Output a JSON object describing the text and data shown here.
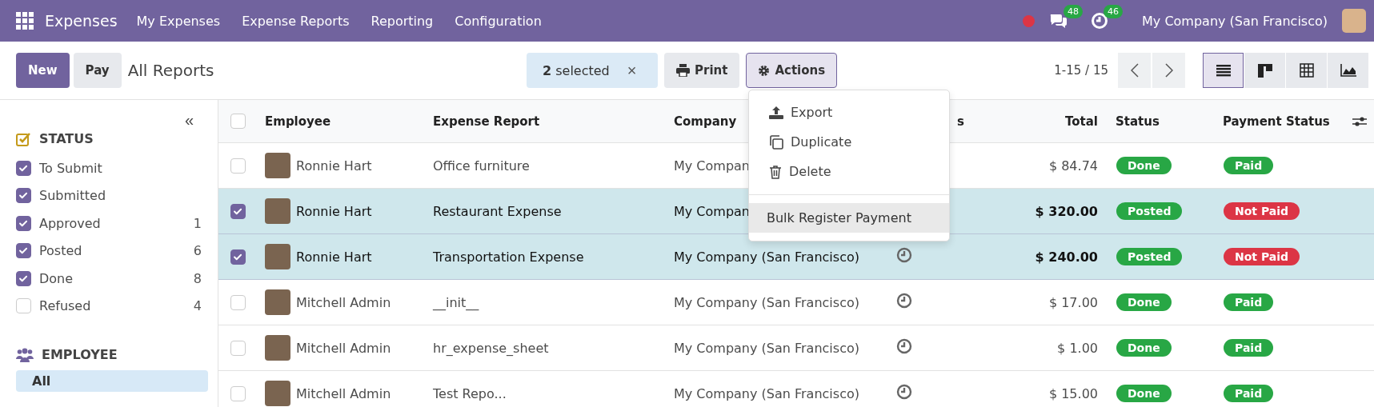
{
  "navbar": {
    "app_name": "Expenses",
    "menu": [
      "My Expenses",
      "Expense Reports",
      "Reporting",
      "Configuration"
    ],
    "chat_count": "48",
    "activity_count": "46",
    "company": "My Company (San Francisco)"
  },
  "toolbar": {
    "new_label": "New",
    "pay_label": "Pay",
    "breadcrumb": "All Reports",
    "selection": "**2** selected",
    "clear_label": "×",
    "print_label": "Print",
    "actions_label": "Actions",
    "actions_open": true,
    "pager": "1-15 / 15",
    "views": [
      {
        "kind": "list",
        "selected": true
      },
      {
        "kind": "kanban",
        "selected": false
      },
      {
        "kind": "pivot",
        "selected": false
      },
      {
        "kind": "graph",
        "selected": false
      }
    ]
  },
  "actions_menu": {
    "items": [
      {
        "kind": "export",
        "label": "Export",
        "highlighted": false
      },
      {
        "kind": "duplicate",
        "label": "Duplicate",
        "highlighted": false
      },
      {
        "kind": "delete",
        "label": "Delete",
        "highlighted": false
      },
      {
        "kind": "separator"
      },
      {
        "kind": "plain",
        "label": "Bulk Register Payment",
        "highlighted": true
      }
    ]
  },
  "sidebar": {
    "collapse": "«",
    "sections": [
      {
        "kind": "checklist",
        "title": "STATUS",
        "items": [
          {
            "label": "To Submit",
            "checked": true
          },
          {
            "label": "Submitted",
            "checked": true
          },
          {
            "label": "Approved",
            "checked": true,
            "count": "1"
          },
          {
            "label": "Posted",
            "checked": true,
            "count": "6"
          },
          {
            "label": "Done",
            "checked": true,
            "count": "8"
          },
          {
            "label": "Refused",
            "checked": false,
            "count": "4"
          }
        ]
      },
      {
        "kind": "list",
        "title": "EMPLOYEE",
        "items": [
          {
            "label": "All",
            "selected": true
          }
        ]
      }
    ]
  },
  "table": {
    "all_selected": false,
    "columns": [
      {
        "label": "Employee"
      },
      {
        "label": "Expense Report"
      },
      {
        "label": "Company"
      },
      {
        "label": "s"
      },
      {
        "label": "Total"
      },
      {
        "label": "Status"
      },
      {
        "label": "Payment Status"
      }
    ],
    "rows": [
      {
        "selected": false,
        "employee": "Ronnie Hart",
        "report": "Office furniture",
        "company": "My Compan",
        "activity": false,
        "total": "$ 84.74",
        "status": {
          "label": "Done",
          "color": "#28a745"
        },
        "payment": {
          "label": "Paid",
          "color": "#28a745"
        }
      },
      {
        "selected": true,
        "employee": "Ronnie Hart",
        "report": "Restaurant Expense",
        "company": "My Compan",
        "activity": false,
        "total": "$ 320.00",
        "status": {
          "label": "Posted",
          "color": "#28a745"
        },
        "payment": {
          "label": "Not Paid",
          "color": "#dc3545"
        }
      },
      {
        "selected": true,
        "employee": "Ronnie Hart",
        "report": "Transportation Expense",
        "company": "My Company (San Francisco)",
        "activity": true,
        "total": "$ 240.00",
        "status": {
          "label": "Posted",
          "color": "#28a745"
        },
        "payment": {
          "label": "Not Paid",
          "color": "#dc3545"
        }
      },
      {
        "selected": false,
        "employee": "Mitchell Admin",
        "report": "__init__",
        "company": "My Company (San Francisco)",
        "activity": true,
        "total": "$ 17.00",
        "status": {
          "label": "Done",
          "color": "#28a745"
        },
        "payment": {
          "label": "Paid",
          "color": "#28a745"
        }
      },
      {
        "selected": false,
        "employee": "Mitchell Admin",
        "report": "hr_expense_sheet",
        "company": "My Company (San Francisco)",
        "activity": true,
        "total": "$ 1.00",
        "status": {
          "label": "Done",
          "color": "#28a745"
        },
        "payment": {
          "label": "Paid",
          "color": "#28a745"
        }
      },
      {
        "selected": false,
        "employee": "Mitchell Admin",
        "report": "Test Repo...",
        "company": "My Company (San Francisco)",
        "activity": true,
        "total": "$ 15.00",
        "status": {
          "label": "Done",
          "color": "#28a745"
        },
        "payment": {
          "label": "Paid",
          "color": "#28a745"
        }
      }
    ]
  }
}
